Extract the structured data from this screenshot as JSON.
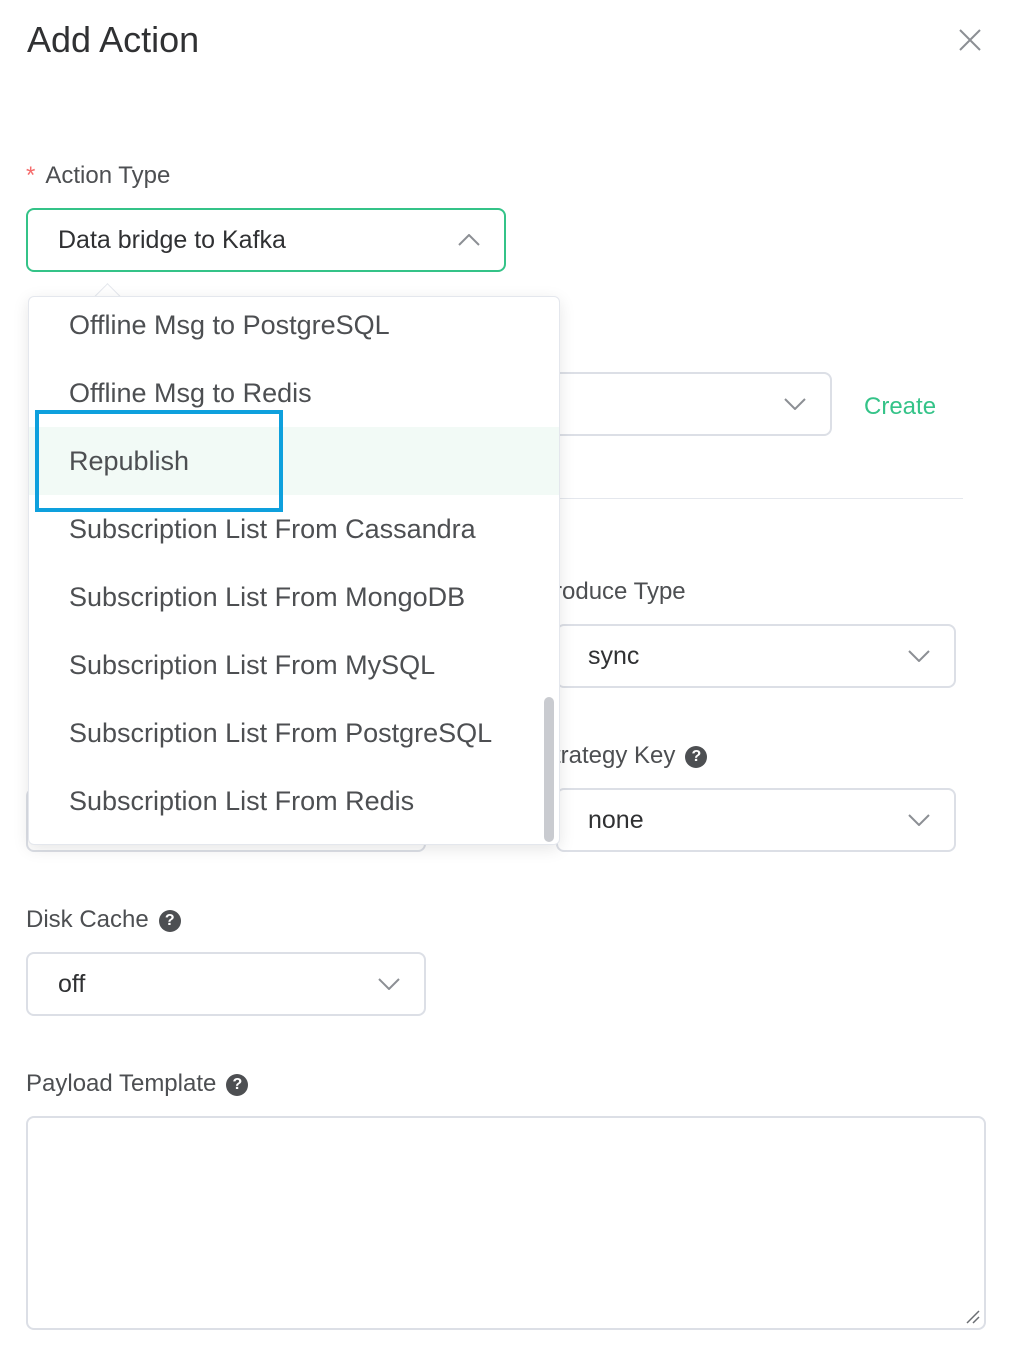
{
  "dialog": {
    "title": "Add Action"
  },
  "action_type": {
    "required_mark": "*",
    "label": "Action Type",
    "value": "Data bridge to Kafka"
  },
  "dropdown": {
    "options": [
      "Offline Msg to PostgreSQL",
      "Offline Msg to Redis",
      "Republish",
      "Subscription List From Cassandra",
      "Subscription List From MongoDB",
      "Subscription List From MySQL",
      "Subscription List From PostgreSQL",
      "Subscription List From Redis"
    ],
    "hovered_option": "Republish"
  },
  "resource": {
    "create_label": "Create"
  },
  "produce_type": {
    "label": "Produce Type",
    "value": "sync"
  },
  "strategy_key": {
    "label": "Strategy Key",
    "help": "?",
    "value": "none"
  },
  "disk_cache": {
    "label": "Disk Cache",
    "help": "?",
    "value": "off"
  },
  "payload_template": {
    "label": "Payload Template",
    "help": "?",
    "value": ""
  },
  "colors": {
    "accent": "#34c388",
    "required": "#f56c6c",
    "highlight_box": "#0ea0dd",
    "hover_bg": "#f2faf6"
  },
  "icons": [
    "close-icon",
    "chevron-up-icon",
    "chevron-down-icon",
    "help-icon",
    "resize-handle-icon"
  ]
}
